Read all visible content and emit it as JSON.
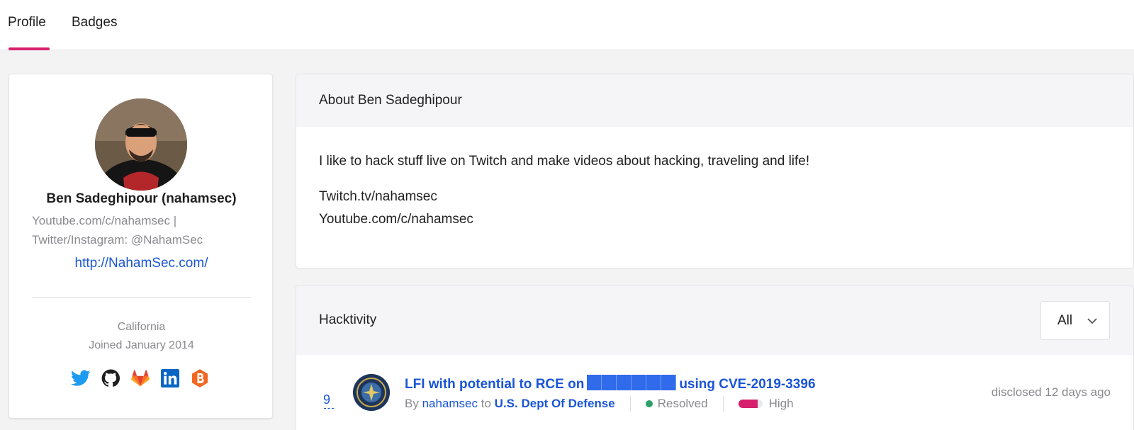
{
  "tabs": {
    "profile": "Profile",
    "badges": "Badges"
  },
  "profile": {
    "name": "Ben Sadeghipour (nahamsec)",
    "bio_line1": "Youtube.com/c/nahamsec |",
    "bio_line2": "Twitter/Instagram: @NahamSec",
    "website": "http://NahamSec.com/",
    "location": "California",
    "joined": "Joined January 2014",
    "socials": [
      "twitter-icon",
      "github-icon",
      "gitlab-icon",
      "linkedin-icon",
      "bugcrowd-icon"
    ]
  },
  "about": {
    "title": "About Ben Sadeghipour",
    "text": "I like to hack stuff live on Twitch and make videos about hacking, traveling and life!",
    "link1": "Twitch.tv/nahamsec",
    "link2": "Youtube.com/c/nahamsec"
  },
  "hacktivity": {
    "title": "Hacktivity",
    "filter": "All",
    "items": [
      {
        "votes": "9",
        "title_prefix": "LFI with potential to RCE on",
        "title_suffix": "using CVE-2019-3396",
        "by_label": "By",
        "reporter": "nahamsec",
        "to_label": "to",
        "program": "U.S. Dept Of Defense",
        "status": "Resolved",
        "severity": "High",
        "disclosed": "disclosed 12 days ago"
      }
    ]
  },
  "colors": {
    "accent": "#d6206d",
    "link": "#1a55d6",
    "resolved": "#2f9e68"
  }
}
